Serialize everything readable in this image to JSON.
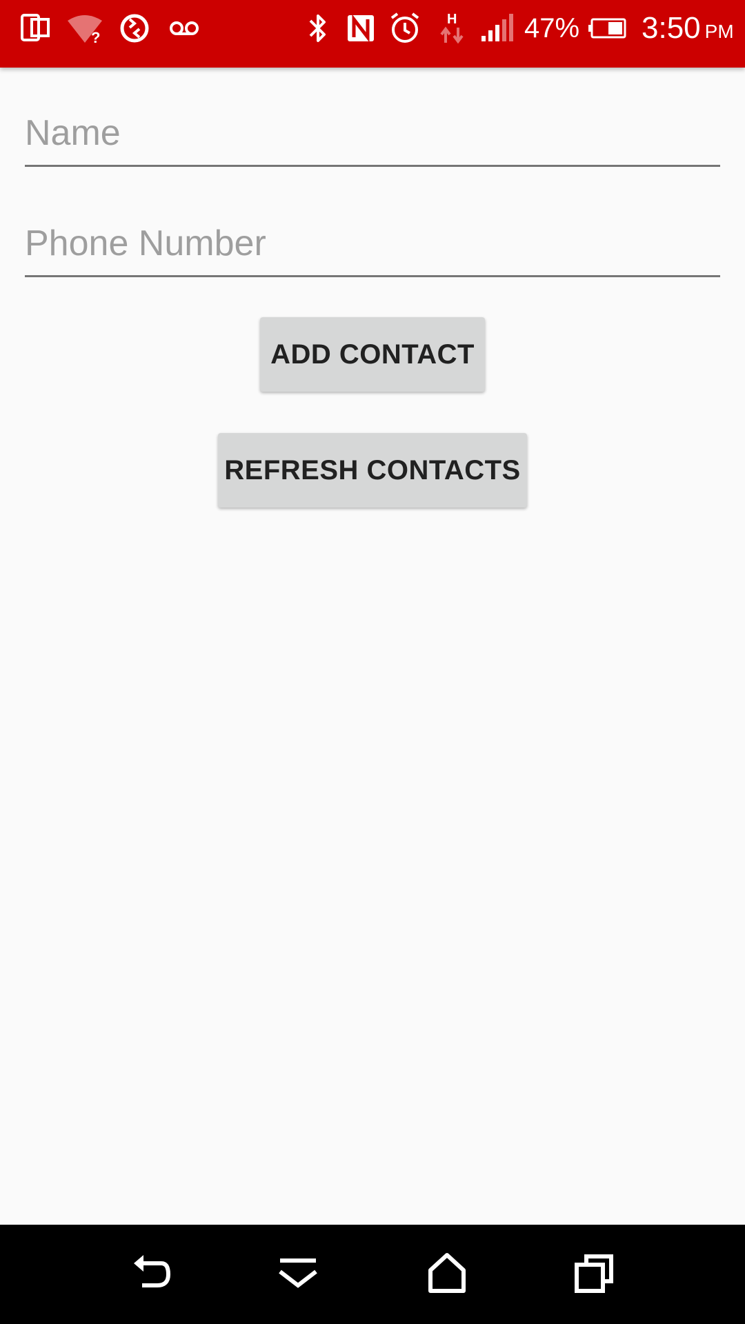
{
  "status_bar": {
    "background_color": "#cc0000",
    "battery_percent": "47%",
    "time": "3:50",
    "ampm": "PM",
    "icons": [
      "screen-icon",
      "wifi-unknown-icon",
      "sync-icon",
      "voicemail-icon",
      "bluetooth-icon",
      "nfc-icon",
      "alarm-icon",
      "h-data-icon",
      "signal-icon",
      "battery-icon"
    ]
  },
  "form": {
    "name_placeholder": "Name",
    "phone_placeholder": "Phone Number",
    "name_value": "",
    "phone_value": ""
  },
  "buttons": {
    "add_contact": "ADD CONTACT",
    "refresh_contacts": "REFRESH CONTACTS"
  },
  "nav_bar": {
    "icons": [
      "back-icon",
      "notifications-shade-icon",
      "home-icon",
      "recents-icon"
    ]
  }
}
